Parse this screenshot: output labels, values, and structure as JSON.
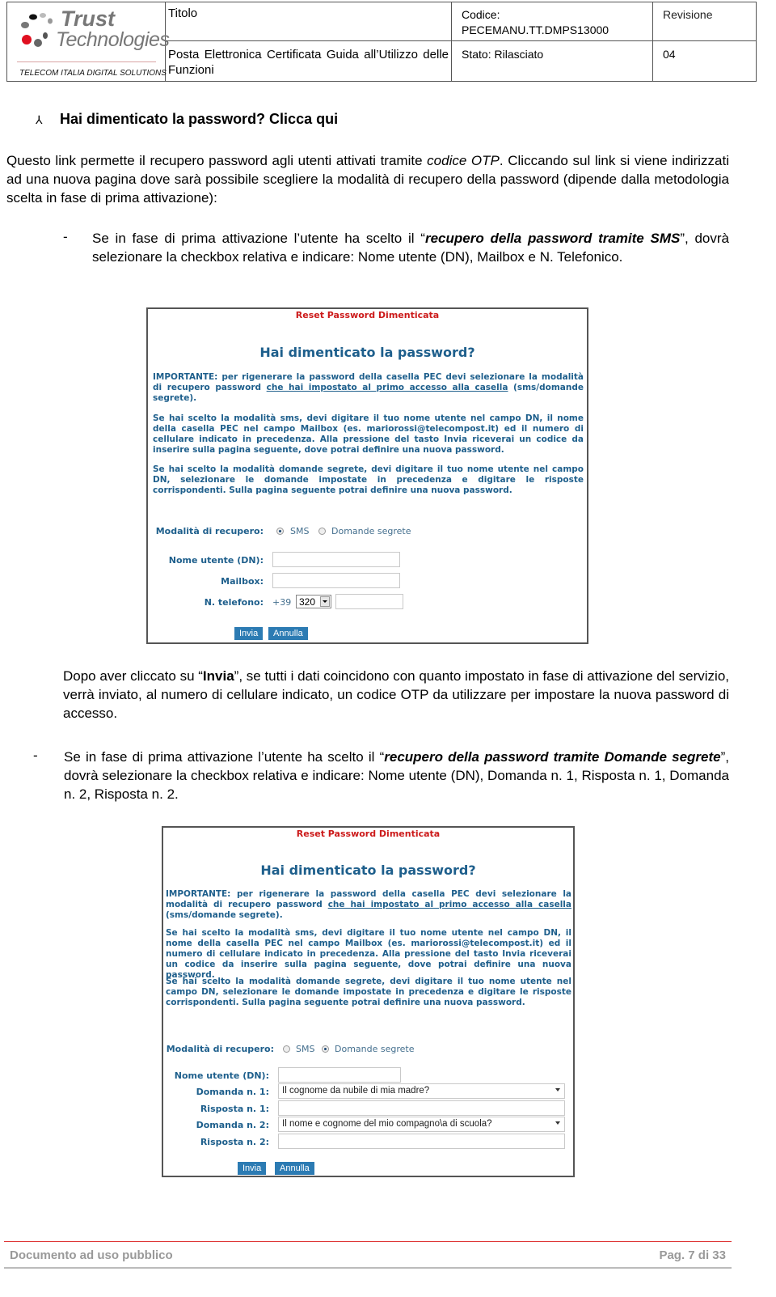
{
  "header": {
    "logo": {
      "line1": "Trust",
      "line2": "Technologies",
      "tagline": "TELECOM ITALIA DIGITAL SOLUTIONS",
      "dot_colors": [
        "#111111",
        "#bbbbbb",
        "#999999",
        "#777777",
        "#e01020",
        "#666666",
        "#555555"
      ]
    },
    "title_label": "Titolo",
    "title_value": "Posta Elettronica Certificata Guida all’Utilizzo delle Funzioni",
    "code_label": "Codice:",
    "code_value": "PECEMANU.TT.DMPS13000",
    "state_label": "Stato:",
    "state_value": "Rilasciato",
    "revision_label": "Revisione",
    "revision_value": "04"
  },
  "section": {
    "bullet_icon": "⅄",
    "heading": "Hai dimenticato la password? Clicca qui",
    "intro_a": "Questo link permette il recupero password agli utenti attivati tramite ",
    "intro_italic": "codice OTP",
    "intro_b": ". Cliccando sul link si viene indirizzati ad una nuova pagina dove sarà possibile scegliere la modalità di recupero della password (dipende dalla metodologia scelta in fase di prima attivazione):",
    "item1": {
      "dash": "-",
      "a": "Se in fase di prima attivazione l’utente ha scelto il “",
      "bold_italic": "recupero della password tramite SMS",
      "b": "”, dovrà selezionare la checkbox relativa e indicare: Nome utente (DN), Mailbox e N. Telefonico."
    },
    "after_shot1": {
      "a": "Dopo aver cliccato su “",
      "bold": "Invia",
      "b": "”, se tutti i dati coincidono con quanto impostato in fase di attivazione del servizio, verrà inviato, al numero di cellulare indicato, un codice OTP da utilizzare per impostare la nuova password di accesso."
    },
    "item2": {
      "dash": "-",
      "a": "Se in fase di prima attivazione l’utente ha scelto il “",
      "bold_italic1": "recupero della password tramite ",
      "bold_italic2": "Domande segrete",
      "b": "”, dovrà selezionare la checkbox relativa e indicare: Nome utente (DN), Domanda n. 1, Risposta n. 1, Domanda n. 2, Risposta n. 2."
    }
  },
  "form_common": {
    "banner": "Reset Password Dimenticata",
    "title": "Hai dimenticato la password?",
    "important_a": "IMPORTANTE: per rigenerare la password della casella PEC devi selezionare la modalità di recupero password ",
    "important_u": "che hai impostato al primo accesso alla casella",
    "important_b": " (sms/domande segrete).",
    "sms_help": "Se hai scelto la modalità sms, devi digitare il tuo nome utente nel campo DN, il nome della casella PEC nel campo Mailbox (es. mariorossi@telecompost.it) ed il numero di cellulare indicato in precedenza. Alla pressione del tasto Invia riceverai un codice da inserire sulla pagina seguente, dove potrai definire una nuova password.",
    "questions_help": "Se hai scelto la modalità domande segrete, devi digitare il tuo nome utente nel campo DN, selezionare le domande impostate in precedenza e digitare le risposte corrispondenti. Sulla pagina seguente potrai definire una nuova password.",
    "mode_label": "Modalità di recupero:",
    "opt_sms": "SMS",
    "opt_questions": "Domande segrete",
    "submit": "Invia",
    "cancel": "Annulla",
    "accent_color": "#1e5f8c",
    "banner_color": "#cc1a1a",
    "button_color": "#2c7bb3"
  },
  "form_sms": {
    "selected_mode": "SMS",
    "username_label": "Nome utente (DN):",
    "username_value": "",
    "mailbox_label": "Mailbox:",
    "mailbox_value": "",
    "phone_label": "N. telefono:",
    "phone_prefix": "+39",
    "phone_operator": "320",
    "phone_value": ""
  },
  "form_questions": {
    "selected_mode": "Domande segrete",
    "username_label": "Nome utente (DN):",
    "q1_label": "Domanda n. 1:",
    "q1_value": "Il cognome da nubile di mia madre?",
    "a1_label": "Risposta n. 1:",
    "q2_label": "Domanda n. 2:",
    "q2_value": "Il nome e cognome del mio compagno\\a di scuola?",
    "a2_label": "Risposta n. 2:"
  },
  "footer": {
    "left": "Documento ad uso pubblico",
    "right": "Pag. 7 di 33"
  }
}
